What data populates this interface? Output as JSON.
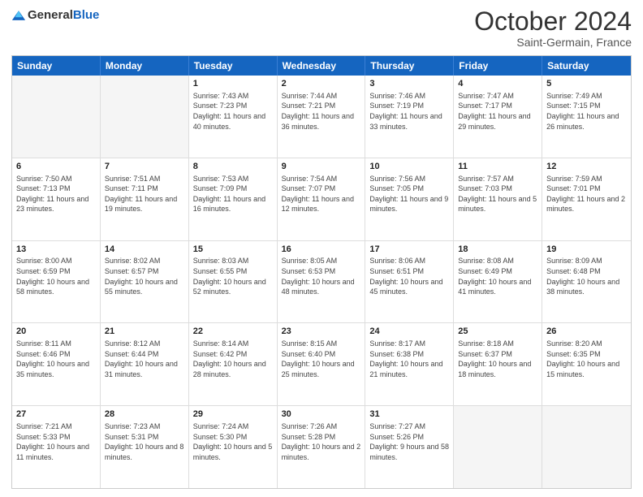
{
  "header": {
    "logo_general": "General",
    "logo_blue": "Blue",
    "month": "October 2024",
    "location": "Saint-Germain, France"
  },
  "days_of_week": [
    "Sunday",
    "Monday",
    "Tuesday",
    "Wednesday",
    "Thursday",
    "Friday",
    "Saturday"
  ],
  "rows": [
    [
      {
        "day": "",
        "empty": true
      },
      {
        "day": "",
        "empty": true
      },
      {
        "day": "1",
        "sunrise": "7:43 AM",
        "sunset": "7:23 PM",
        "daylight": "11 hours and 40 minutes."
      },
      {
        "day": "2",
        "sunrise": "7:44 AM",
        "sunset": "7:21 PM",
        "daylight": "11 hours and 36 minutes."
      },
      {
        "day": "3",
        "sunrise": "7:46 AM",
        "sunset": "7:19 PM",
        "daylight": "11 hours and 33 minutes."
      },
      {
        "day": "4",
        "sunrise": "7:47 AM",
        "sunset": "7:17 PM",
        "daylight": "11 hours and 29 minutes."
      },
      {
        "day": "5",
        "sunrise": "7:49 AM",
        "sunset": "7:15 PM",
        "daylight": "11 hours and 26 minutes."
      }
    ],
    [
      {
        "day": "6",
        "sunrise": "7:50 AM",
        "sunset": "7:13 PM",
        "daylight": "11 hours and 23 minutes."
      },
      {
        "day": "7",
        "sunrise": "7:51 AM",
        "sunset": "7:11 PM",
        "daylight": "11 hours and 19 minutes."
      },
      {
        "day": "8",
        "sunrise": "7:53 AM",
        "sunset": "7:09 PM",
        "daylight": "11 hours and 16 minutes."
      },
      {
        "day": "9",
        "sunrise": "7:54 AM",
        "sunset": "7:07 PM",
        "daylight": "11 hours and 12 minutes."
      },
      {
        "day": "10",
        "sunrise": "7:56 AM",
        "sunset": "7:05 PM",
        "daylight": "11 hours and 9 minutes."
      },
      {
        "day": "11",
        "sunrise": "7:57 AM",
        "sunset": "7:03 PM",
        "daylight": "11 hours and 5 minutes."
      },
      {
        "day": "12",
        "sunrise": "7:59 AM",
        "sunset": "7:01 PM",
        "daylight": "11 hours and 2 minutes."
      }
    ],
    [
      {
        "day": "13",
        "sunrise": "8:00 AM",
        "sunset": "6:59 PM",
        "daylight": "10 hours and 58 minutes."
      },
      {
        "day": "14",
        "sunrise": "8:02 AM",
        "sunset": "6:57 PM",
        "daylight": "10 hours and 55 minutes."
      },
      {
        "day": "15",
        "sunrise": "8:03 AM",
        "sunset": "6:55 PM",
        "daylight": "10 hours and 52 minutes."
      },
      {
        "day": "16",
        "sunrise": "8:05 AM",
        "sunset": "6:53 PM",
        "daylight": "10 hours and 48 minutes."
      },
      {
        "day": "17",
        "sunrise": "8:06 AM",
        "sunset": "6:51 PM",
        "daylight": "10 hours and 45 minutes."
      },
      {
        "day": "18",
        "sunrise": "8:08 AM",
        "sunset": "6:49 PM",
        "daylight": "10 hours and 41 minutes."
      },
      {
        "day": "19",
        "sunrise": "8:09 AM",
        "sunset": "6:48 PM",
        "daylight": "10 hours and 38 minutes."
      }
    ],
    [
      {
        "day": "20",
        "sunrise": "8:11 AM",
        "sunset": "6:46 PM",
        "daylight": "10 hours and 35 minutes."
      },
      {
        "day": "21",
        "sunrise": "8:12 AM",
        "sunset": "6:44 PM",
        "daylight": "10 hours and 31 minutes."
      },
      {
        "day": "22",
        "sunrise": "8:14 AM",
        "sunset": "6:42 PM",
        "daylight": "10 hours and 28 minutes."
      },
      {
        "day": "23",
        "sunrise": "8:15 AM",
        "sunset": "6:40 PM",
        "daylight": "10 hours and 25 minutes."
      },
      {
        "day": "24",
        "sunrise": "8:17 AM",
        "sunset": "6:38 PM",
        "daylight": "10 hours and 21 minutes."
      },
      {
        "day": "25",
        "sunrise": "8:18 AM",
        "sunset": "6:37 PM",
        "daylight": "10 hours and 18 minutes."
      },
      {
        "day": "26",
        "sunrise": "8:20 AM",
        "sunset": "6:35 PM",
        "daylight": "10 hours and 15 minutes."
      }
    ],
    [
      {
        "day": "27",
        "sunrise": "7:21 AM",
        "sunset": "5:33 PM",
        "daylight": "10 hours and 11 minutes."
      },
      {
        "day": "28",
        "sunrise": "7:23 AM",
        "sunset": "5:31 PM",
        "daylight": "10 hours and 8 minutes."
      },
      {
        "day": "29",
        "sunrise": "7:24 AM",
        "sunset": "5:30 PM",
        "daylight": "10 hours and 5 minutes."
      },
      {
        "day": "30",
        "sunrise": "7:26 AM",
        "sunset": "5:28 PM",
        "daylight": "10 hours and 2 minutes."
      },
      {
        "day": "31",
        "sunrise": "7:27 AM",
        "sunset": "5:26 PM",
        "daylight": "9 hours and 58 minutes."
      },
      {
        "day": "",
        "empty": true
      },
      {
        "day": "",
        "empty": true
      }
    ]
  ]
}
